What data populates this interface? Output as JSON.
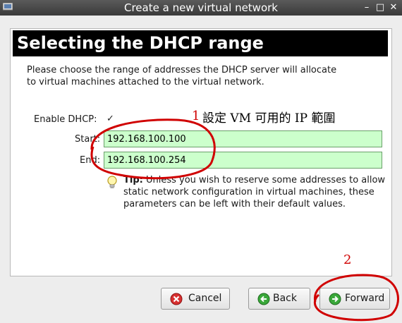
{
  "window": {
    "title": "Create a new virtual network",
    "controls": {
      "minimize": "–",
      "maximize": "□",
      "close": "✕"
    }
  },
  "page": {
    "heading": "Selecting the DHCP range",
    "description": "Please choose the range of addresses the DHCP server will allocate to virtual machines attached to the virtual network."
  },
  "form": {
    "enable_label": "Enable DHCP:",
    "enable_checked": true,
    "start_label": "Start:",
    "start_value": "192.168.100.100",
    "end_label": "End:",
    "end_value": "192.168.100.254"
  },
  "tip": {
    "bold": "Tip:",
    "text": "Unless you wish to reserve some addresses to allow static network configuration in virtual machines, these parameters can be left with their default values."
  },
  "buttons": {
    "cancel": "Cancel",
    "back": "Back",
    "forward": "Forward"
  },
  "annotations": {
    "number_1": "1",
    "text_1": "設定 VM 可用的 IP 範圍",
    "number_2": "2",
    "color": "#dd0000"
  }
}
